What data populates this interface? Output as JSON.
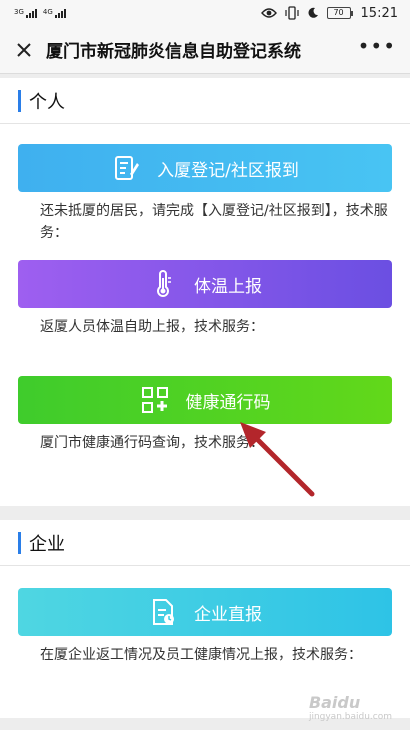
{
  "status": {
    "signal1": "3G",
    "signal2": "4G",
    "battery": "70",
    "time": "15:21"
  },
  "header": {
    "title": "厦门市新冠肺炎信息自助登记系统",
    "more": "•••"
  },
  "personal": {
    "heading": "个人",
    "buttons": [
      {
        "label": "入厦登记/社区报到",
        "desc": "还未抵厦的居民，请完成【入厦登记/社区报到】，技术服务：",
        "icon": "register-icon"
      },
      {
        "label": "体温上报",
        "desc": "返厦人员体温自助上报，技术服务：",
        "icon": "thermometer-icon"
      },
      {
        "label": "健康通行码",
        "desc": "厦门市健康通行码查询，技术服务：",
        "icon": "health-code-icon"
      }
    ]
  },
  "company": {
    "heading": "企业",
    "buttons": [
      {
        "label": "企业直报",
        "desc": "在厦企业返工情况及员工健康情况上报，技术服务：",
        "icon": "report-icon"
      }
    ]
  },
  "watermark": {
    "brand": "Baidu",
    "sub": "jingyan.baidu.com"
  },
  "colors": {
    "accent": "#2a7ee8",
    "register": "#3fb0ef",
    "temp": "#7b52e6",
    "health": "#4fd024",
    "company": "#3dcde4",
    "arrow": "#b3262b"
  }
}
